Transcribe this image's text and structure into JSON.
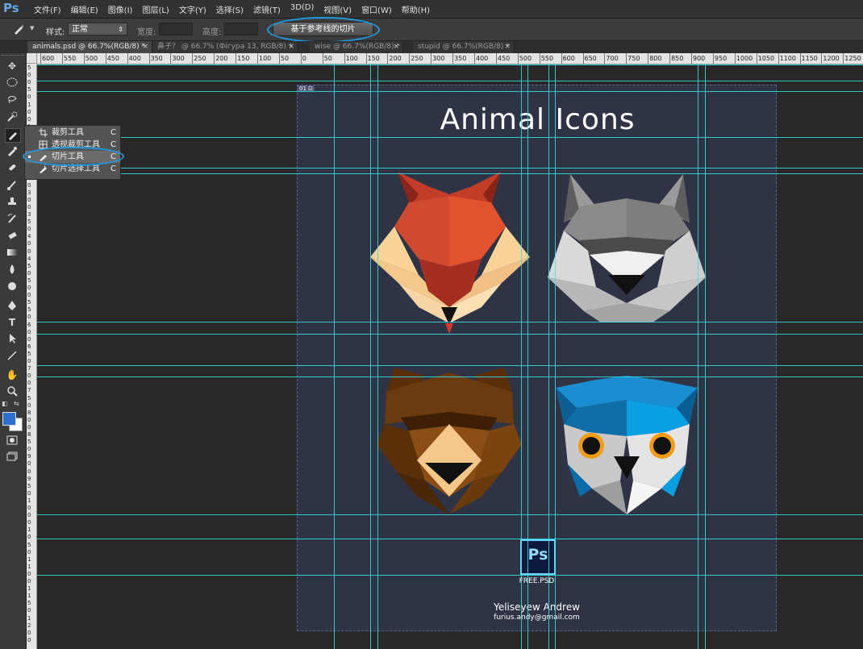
{
  "app": {
    "logo": "Ps"
  },
  "menu": [
    "文件(F)",
    "编辑(E)",
    "图像(I)",
    "图层(L)",
    "文字(Y)",
    "选择(S)",
    "滤镜(T)",
    "3D(D)",
    "视图(V)",
    "窗口(W)",
    "帮助(H)"
  ],
  "options": {
    "style_label": "样式:",
    "style_value": "正常",
    "width_label": "宽度:",
    "height_label": "高度:",
    "slices_from_guides": "基于参考线的切片"
  },
  "tabs": [
    {
      "label": "animals.psd @ 66.7%(RGB/8) *",
      "close": "×"
    },
    {
      "label": "鼻子？ @ 66.7% (Фігура 13, RGB/8) *",
      "close": "×"
    },
    {
      "label": "wise @ 66.7%(RGB/8) *",
      "close": "×"
    },
    {
      "label": "stupid @ 66.7%(RGB/8) *",
      "close": "×"
    }
  ],
  "ruler_h": [
    "600",
    "550",
    "500",
    "450",
    "400",
    "350",
    "300",
    "250",
    "200",
    "150",
    "100",
    "50",
    "0",
    "50",
    "100",
    "150",
    "200",
    "250",
    "300",
    "350",
    "400",
    "450",
    "500",
    "550",
    "600",
    "650",
    "700",
    "750",
    "800",
    "850",
    "900",
    "950",
    "1000",
    "1050",
    "1100",
    "1150",
    "1200",
    "1250"
  ],
  "ruler_v": [
    "5",
    "0",
    "0",
    "5",
    "0",
    "1",
    "0",
    "0",
    "1",
    "5",
    "0",
    "2",
    "0",
    "0",
    "2",
    "5",
    "0",
    "3",
    "0",
    "0",
    "3",
    "5",
    "0",
    "4",
    "0",
    "0",
    "4",
    "5",
    "0",
    "5",
    "0",
    "0",
    "5",
    "5",
    "0",
    "6",
    "0",
    "0",
    "6",
    "5",
    "0",
    "7",
    "0",
    "0",
    "7",
    "5",
    "0",
    "8",
    "0",
    "0",
    "8",
    "5",
    "0",
    "9",
    "0",
    "0",
    "9",
    "5",
    "0",
    "1",
    "0",
    "0",
    "0",
    "1",
    "0",
    "5",
    "0",
    "1",
    "1",
    "0",
    "0",
    "1",
    "1",
    "5",
    "0",
    "1",
    "2",
    "0",
    "0"
  ],
  "flyout": [
    {
      "label": "裁剪工具",
      "key": "C",
      "icon": "crop-icon"
    },
    {
      "label": "透视裁剪工具",
      "key": "C",
      "icon": "perspective-crop-icon"
    },
    {
      "label": "切片工具",
      "key": "C",
      "icon": "slice-icon"
    },
    {
      "label": "切片选择工具",
      "key": "C",
      "icon": "slice-select-icon"
    }
  ],
  "canvas": {
    "slice_tag": "01 ⊡",
    "title": "Animal Icons",
    "badge": "Ps",
    "badge_caption": "FREE.PSD",
    "author": "Yeliseyew Andrew",
    "email": "furius.andy@gmail.com"
  },
  "colors": {
    "foreground": "#2e6fd0",
    "background": "#ffffff",
    "guide": "#34e5e5",
    "canvas": "#2e3346",
    "highlight": "#1e9be0"
  }
}
